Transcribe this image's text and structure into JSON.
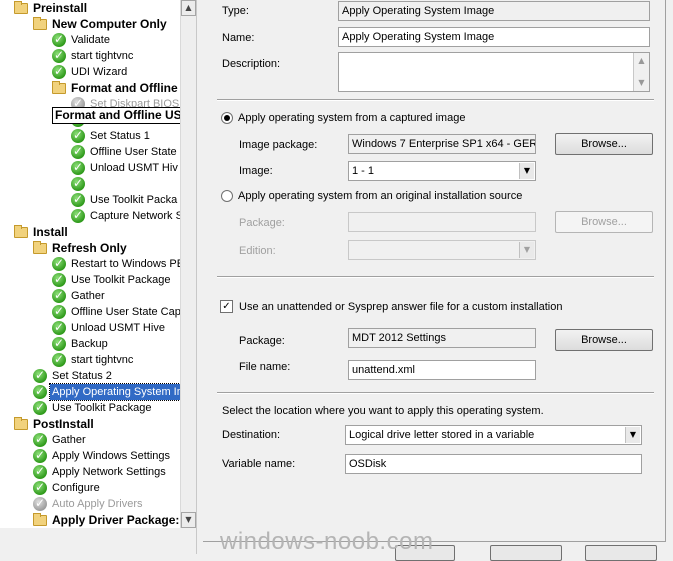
{
  "tree": {
    "tooltip": "Format and Offline USMT",
    "items": [
      {
        "label": "Preinstall",
        "type": "group",
        "depth": 0
      },
      {
        "label": "New Computer Only",
        "type": "group",
        "depth": 1
      },
      {
        "label": "Validate",
        "type": "step",
        "depth": 2
      },
      {
        "label": "start tightvnc",
        "type": "step",
        "depth": 2
      },
      {
        "label": "UDI Wizard",
        "type": "step",
        "depth": 2
      },
      {
        "label": "Format and Offline",
        "type": "group",
        "depth": 2
      },
      {
        "label": "Set Diskpart BIOS",
        "type": "step-disabled",
        "depth": 3
      },
      {
        "label": "",
        "type": "step",
        "depth": 3
      },
      {
        "label": "Set Status 1",
        "type": "step",
        "depth": 3
      },
      {
        "label": "Offline User State (",
        "type": "step",
        "depth": 3
      },
      {
        "label": "Unload USMT Hiv",
        "type": "step",
        "depth": 3
      },
      {
        "label": "",
        "type": "step",
        "depth": 3
      },
      {
        "label": "Use Toolkit Packa",
        "type": "step",
        "depth": 3
      },
      {
        "label": "Capture Network S",
        "type": "step",
        "depth": 3
      },
      {
        "label": "Install",
        "type": "group",
        "depth": 0
      },
      {
        "label": "Refresh Only",
        "type": "group",
        "depth": 1
      },
      {
        "label": "Restart to Windows PE",
        "type": "step",
        "depth": 2
      },
      {
        "label": "Use Toolkit Package",
        "type": "step",
        "depth": 2
      },
      {
        "label": "Gather",
        "type": "step",
        "depth": 2
      },
      {
        "label": "Offline User State Capt",
        "type": "step",
        "depth": 2
      },
      {
        "label": "Unload USMT Hive",
        "type": "step",
        "depth": 2
      },
      {
        "label": "Backup",
        "type": "step",
        "depth": 2
      },
      {
        "label": "start tightvnc",
        "type": "step",
        "depth": 2
      },
      {
        "label": "Set Status 2",
        "type": "step",
        "depth": 1
      },
      {
        "label": "Apply Operating System Im",
        "type": "step-selected",
        "depth": 1
      },
      {
        "label": "Use Toolkit Package",
        "type": "step",
        "depth": 1
      },
      {
        "label": "PostInstall",
        "type": "group",
        "depth": 0
      },
      {
        "label": "Gather",
        "type": "step",
        "depth": 1
      },
      {
        "label": "Apply Windows Settings",
        "type": "step",
        "depth": 1
      },
      {
        "label": "Apply Network Settings",
        "type": "step",
        "depth": 1
      },
      {
        "label": "Configure",
        "type": "step",
        "depth": 1
      },
      {
        "label": "Auto Apply Drivers",
        "type": "step-disabled",
        "depth": 1
      },
      {
        "label": "Apply Driver Package:",
        "type": "group",
        "depth": 1
      }
    ]
  },
  "props": {
    "type_label": "Type:",
    "type_value": "Apply Operating System Image",
    "name_label": "Name:",
    "name_value": "Apply Operating System Image",
    "description_label": "Description:",
    "description_value": "",
    "captured_radio_label": "Apply operating system from a captured image",
    "image_package_label": "Image package:",
    "image_package_value": "Windows 7 Enterprise SP1 x64 - GER",
    "browse_label": "Browse...",
    "image_label": "Image:",
    "image_value": "1 - 1",
    "original_radio_label": "Apply operating system from an original installation source",
    "package_label": "Package:",
    "package_value": "",
    "edition_label": "Edition:",
    "edition_value": "",
    "answer_file_label": "Use an unattended or Sysprep answer file for a custom installation",
    "answer_package_label": "Package:",
    "answer_package_value": "MDT 2012 Settings",
    "file_name_label": "File name:",
    "file_name_value": "unattend.xml",
    "location_text": "Select the location where you want to apply this operating system.",
    "destination_label": "Destination:",
    "destination_value": "Logical drive letter stored in a variable",
    "variable_name_label": "Variable name:",
    "variable_name_value": "OSDisk"
  },
  "watermark": "windows-noob.com"
}
